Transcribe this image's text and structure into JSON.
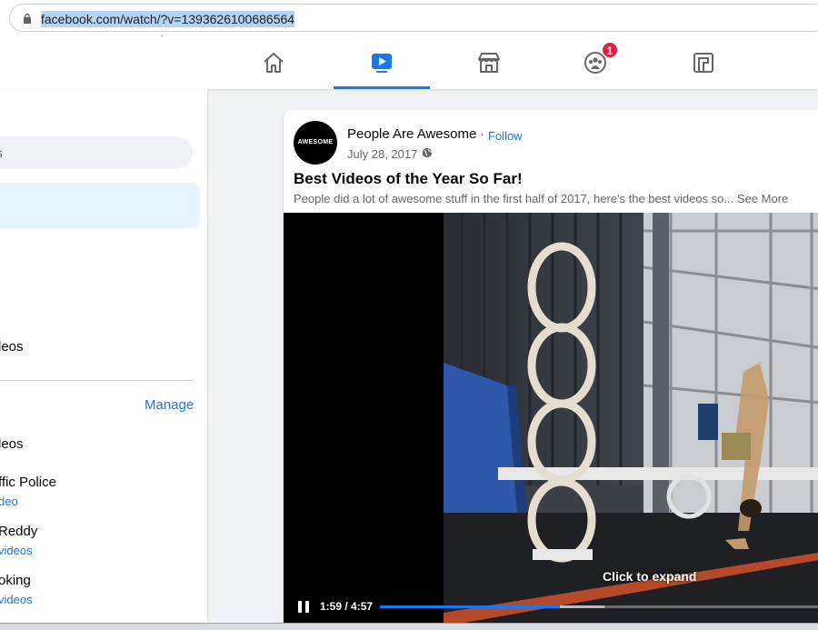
{
  "browser": {
    "url": "facebook.com/watch/?v=1393626100686564"
  },
  "nav": {
    "tabs": [
      {
        "name": "home",
        "icon": "home-icon"
      },
      {
        "name": "watch",
        "icon": "video-play-icon",
        "active": true
      },
      {
        "name": "marketplace",
        "icon": "store-icon"
      },
      {
        "name": "groups",
        "icon": "groups-icon",
        "badge": "1"
      },
      {
        "name": "gaming",
        "icon": "gaming-icon"
      }
    ],
    "accent": "#1877f2",
    "badge_color": "#e41e3f"
  },
  "sidebar": {
    "search_placeholder": "os",
    "item_saved": "leos",
    "manage_label": "Manage",
    "following": [
      {
        "name": "leos",
        "sub": ""
      },
      {
        "name": "ffic Police",
        "sub": "deo"
      },
      {
        "name": "Reddy",
        "sub": "videos"
      },
      {
        "name": "oking",
        "sub": "videos"
      }
    ]
  },
  "post": {
    "page_name": "People Are Awesome",
    "avatar_text": "AWESOME",
    "separator": "·",
    "follow_label": "Follow",
    "date": "July 28, 2017 ·",
    "title": "Best Videos of the Year So Far!",
    "description": "People did a lot of awesome stuff in the first half of 2017, here's the best videos so...",
    "see_more": "See More"
  },
  "video": {
    "overlay_text": "Click to expand",
    "time": "1:59 / 4:57",
    "played_fraction": 0.4,
    "buffered_fraction": 0.5
  }
}
